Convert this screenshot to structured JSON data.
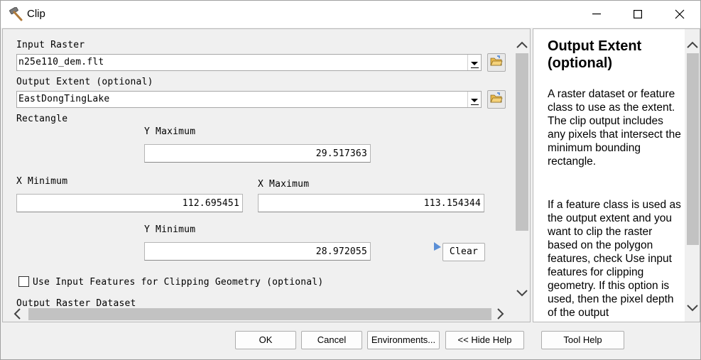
{
  "window": {
    "title": "Clip",
    "icon": "hammer-icon",
    "controls": {
      "minimize_icon": "minimize-icon",
      "maximize_icon": "maximize-icon",
      "close_icon": "close-icon"
    }
  },
  "form": {
    "input_raster": {
      "label": "Input Raster",
      "value": "n25e110_dem.flt"
    },
    "output_extent": {
      "label": "Output Extent (optional)",
      "value": "EastDongTingLake"
    },
    "rectangle": {
      "label": "Rectangle",
      "y_max_label": "Y Maximum",
      "y_max_value": "29.517363",
      "x_min_label": "X Minimum",
      "x_min_value": "112.695451",
      "x_max_label": "X Maximum",
      "x_max_value": "113.154344",
      "y_min_label": "Y Minimum",
      "y_min_value": "28.972055",
      "clear_label": "Clear"
    },
    "use_input_features": {
      "label": "Use Input Features for Clipping Geometry (optional)",
      "checked": false
    },
    "output_raster_label": "Output Raster Dataset"
  },
  "help": {
    "title": "Output Extent (optional)",
    "paragraphs": [
      "A raster dataset or feature class to use as the extent. The clip output includes any pixels that intersect the minimum bounding rectangle.",
      "If a feature class is used as the output extent and you want to clip the raster based on the polygon features, check Use input features for clipping geometry. If this option is used, then the pixel depth of the output"
    ]
  },
  "buttons": {
    "ok": "OK",
    "cancel": "Cancel",
    "environments": "Environments...",
    "hide_help": "<< Hide Help",
    "tool_help": "Tool Help"
  },
  "colors": {
    "folder_icon": "#e8b84a",
    "scrollbar_thumb": "#c2c2c2",
    "accent_arrow": "#3a7bd5"
  }
}
